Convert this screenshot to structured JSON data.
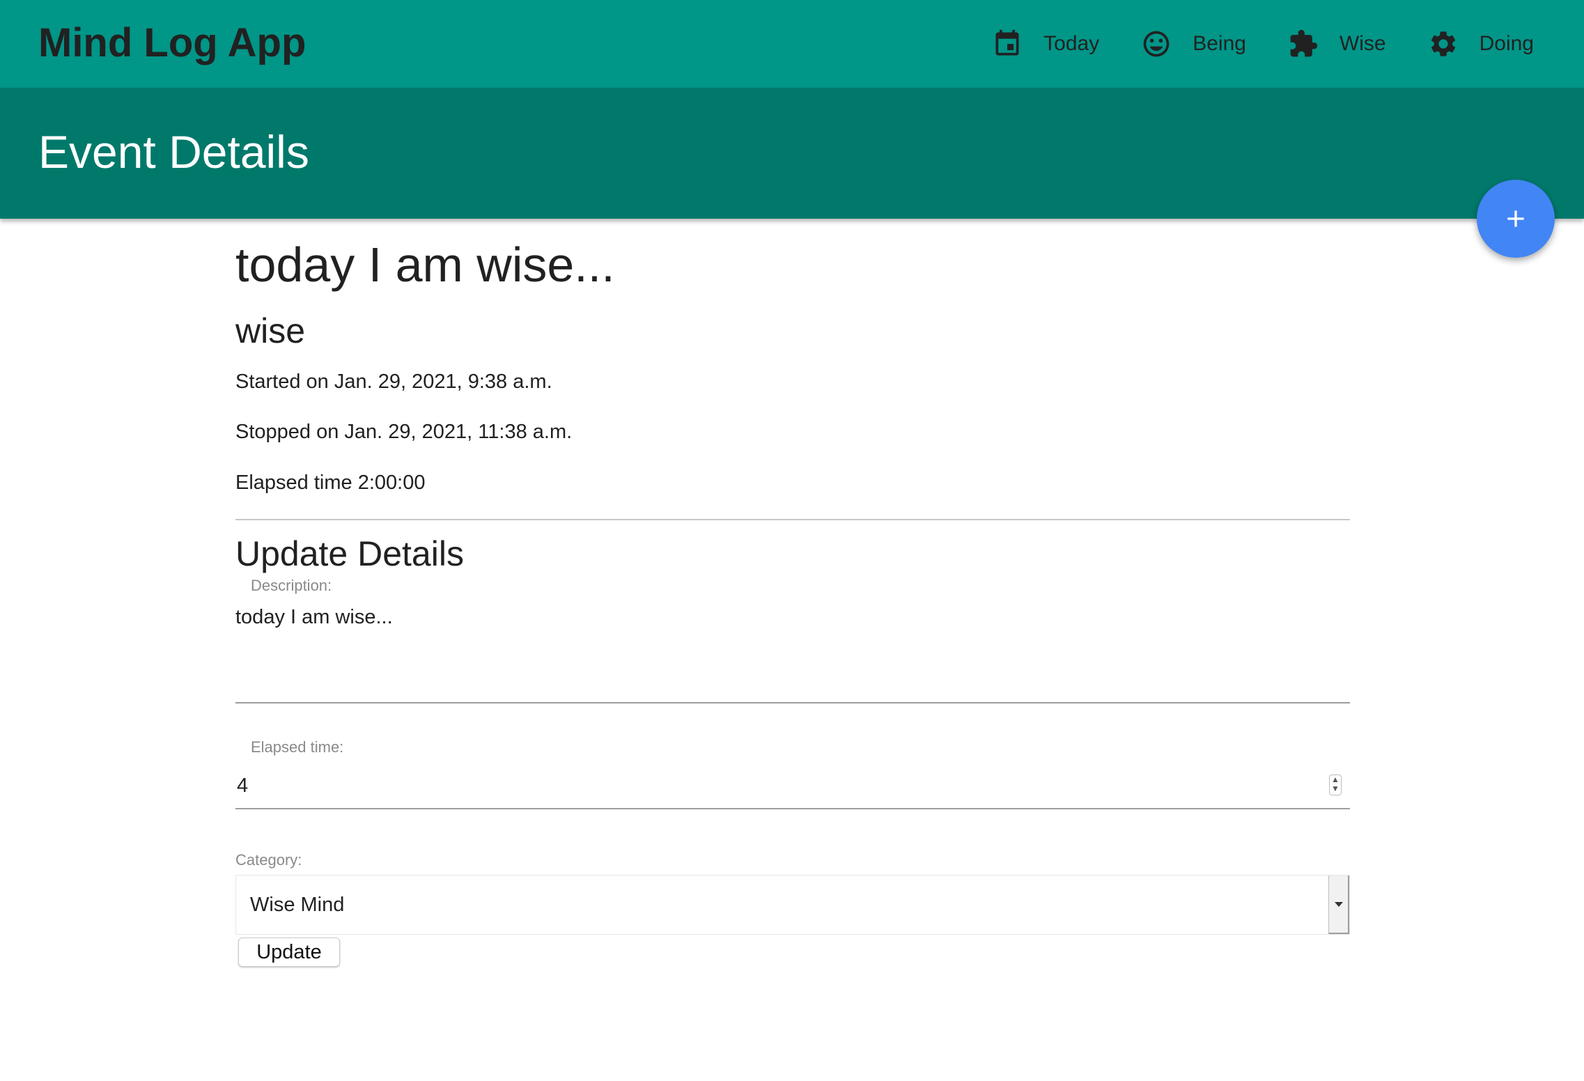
{
  "topbar": {
    "app_title": "Mind Log App",
    "nav": [
      {
        "label": "Today",
        "icon": "calendar-icon"
      },
      {
        "label": "Being",
        "icon": "smiley-icon"
      },
      {
        "label": "Wise",
        "icon": "puzzle-icon"
      },
      {
        "label": "Doing",
        "icon": "gear-icon"
      }
    ]
  },
  "page_header": {
    "title": "Event Details"
  },
  "fab": {
    "icon": "plus-icon"
  },
  "event": {
    "title": "today I am wise...",
    "category": "wise",
    "started": "Started on Jan. 29, 2021, 9:38 a.m.",
    "stopped": "Stopped on Jan. 29, 2021, 11:38 a.m.",
    "elapsed": "Elapsed time 2:00:00"
  },
  "form": {
    "section_title": "Update Details",
    "description_label": "Description:",
    "description_value": "today I am wise...",
    "elapsed_label": "Elapsed time:",
    "elapsed_value": "4",
    "category_label": "Category:",
    "category_value": "Wise Mind",
    "update_label": "Update"
  },
  "colors": {
    "topbar": "#009688",
    "page_header": "#00796b",
    "fab": "#4285f4",
    "text": "#212121"
  }
}
